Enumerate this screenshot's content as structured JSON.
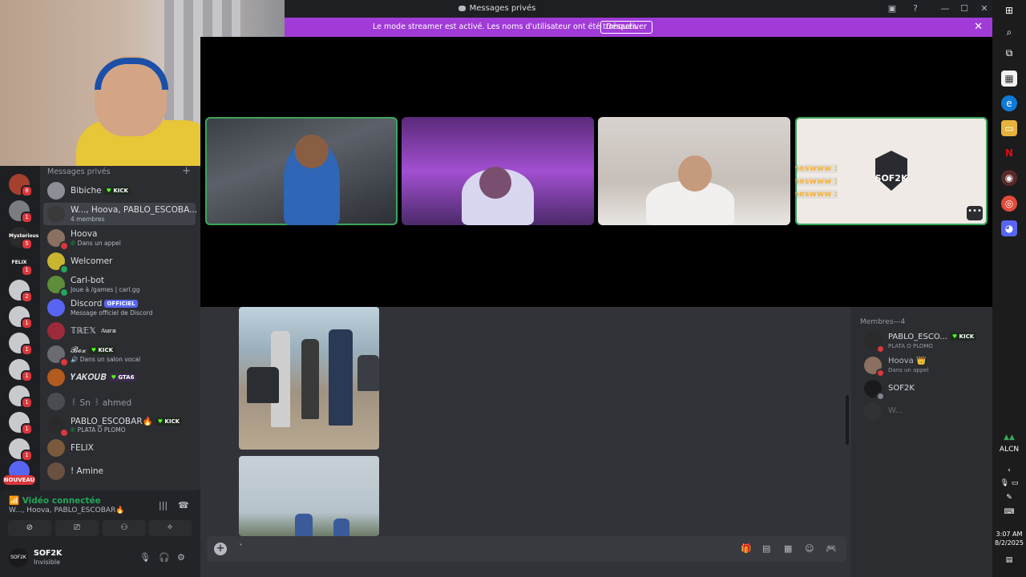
{
  "window": {
    "title": "Messages privés"
  },
  "banner": {
    "text": "Le mode streamer est activé. Les noms d'utilisateur ont été tronqués.",
    "button": "Désactiver"
  },
  "video": {
    "tiles": [
      {
        "id": "tile-1",
        "speaking": true
      },
      {
        "id": "tile-2",
        "speaking": false
      },
      {
        "id": "tile-3",
        "speaking": false
      },
      {
        "id": "tile-4",
        "speaking": true,
        "logo_text": "SOF2K"
      }
    ],
    "overlay_chat": [
      "comyouneswww :",
      "comyouneswww :",
      "comyouneswww :"
    ]
  },
  "servers": [
    {
      "label": "",
      "badge": "8"
    },
    {
      "label": "",
      "badge": "1"
    },
    {
      "label": "Mysterious",
      "badge": "5"
    },
    {
      "label": "FELIX",
      "badge": "1"
    },
    {
      "label": "",
      "badge": "2"
    },
    {
      "label": "",
      "badge": "1"
    },
    {
      "label": "",
      "badge": "1"
    },
    {
      "label": "",
      "badge": "1"
    },
    {
      "label": "",
      "badge": "1"
    },
    {
      "label": "",
      "badge": "1"
    },
    {
      "label": "",
      "badge": "1"
    }
  ],
  "new_badge": "NOUVEAU",
  "dm": {
    "header": "Messages privés",
    "items": [
      {
        "name": "Bibiche",
        "tag": "KICK",
        "sub": ""
      },
      {
        "name": "W..., Hoova, PABLO_ESCOBA...",
        "sub": "4 membres",
        "active": true
      },
      {
        "name": "Hoova",
        "sub": "Dans un appel"
      },
      {
        "name": "Welcomer",
        "sub": ""
      },
      {
        "name": "Carl-bot",
        "sub": "Joue à /games | carl.gg"
      },
      {
        "name": "Discord",
        "tag": "OFFICIEL",
        "sub": "Message officiel de Discord"
      },
      {
        "name": "𝕋ℝ𝔼𝕏",
        "tag": "𝔸𝕦𝕣𝕒",
        "sub": ""
      },
      {
        "name": "𝓑𝓸𝔁",
        "tag": "KICK",
        "sub": "Dans un salon vocal"
      },
      {
        "name": "𝒀𝑨𝑲𝑶𝑼𝑩",
        "tag": "GTA6",
        "sub": ""
      },
      {
        "name": "꒰ Sn ꒱ ahmed",
        "sub": ""
      },
      {
        "name": "PABLO_ESCOBAR🔥",
        "tag": "KICK",
        "sub": "PLATA O PLOMO"
      },
      {
        "name": "FELIX",
        "sub": ""
      },
      {
        "name": "! Amine",
        "sub": ""
      }
    ]
  },
  "voice": {
    "status": "Vidéo connectée",
    "channel": "W..., Hoova, PABLO_ESCOBAR🔥"
  },
  "user": {
    "name": "SOF2K",
    "status": "Invisible",
    "avatar_text": "SOF2K"
  },
  "composer": {
    "placeholder": "`"
  },
  "members": {
    "header": "Membres—4",
    "items": [
      {
        "name": "PABLO_ESCO...",
        "tag": "KICK",
        "sub": "PLATA O PLOMO"
      },
      {
        "name": "Hoova 👑",
        "sub": "Dans un appel"
      },
      {
        "name": "SOF2K",
        "sub": ""
      },
      {
        "name": "W...",
        "sub": ""
      }
    ]
  },
  "taskbar": {
    "ticker": "ALCN",
    "time": "3:07 AM",
    "date": "8/2/2025"
  },
  "colors": {
    "banner": "#a13bd8",
    "speaking": "#3ba55d",
    "online": "#23a55a",
    "dnd": "#da373c"
  }
}
